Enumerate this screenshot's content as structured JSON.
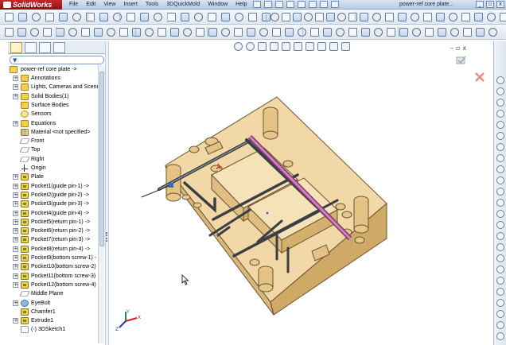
{
  "app": {
    "brand": "SolidWorks",
    "document_title": "power-ref core plate...",
    "menus": [
      "File",
      "Edit",
      "View",
      "Insert",
      "Tools",
      "3DQuickMold",
      "Window",
      "Help"
    ]
  },
  "window_controls": [
    "_",
    "▫",
    "x"
  ],
  "viewport_controls": [
    "–",
    "▫",
    "x"
  ],
  "feature_tree": {
    "root": "power-ref core plate ->",
    "items": [
      {
        "label": "Annotations",
        "icon": "folder-a",
        "expand": "+"
      },
      {
        "label": "Lights, Cameras and Scene",
        "icon": "folder",
        "expand": "+"
      },
      {
        "label": "Solid Bodies(1)",
        "icon": "folder",
        "expand": "+"
      },
      {
        "label": "Surface Bodies",
        "icon": "folder",
        "expand": ""
      },
      {
        "label": "Sensors",
        "icon": "sensor",
        "expand": ""
      },
      {
        "label": "Equations",
        "icon": "folder",
        "expand": "+"
      },
      {
        "label": "Material <not specified>",
        "icon": "mat",
        "expand": ""
      },
      {
        "label": "Front",
        "icon": "plane",
        "expand": ""
      },
      {
        "label": "Top",
        "icon": "plane",
        "expand": ""
      },
      {
        "label": "Right",
        "icon": "plane",
        "expand": ""
      },
      {
        "label": "Origin",
        "icon": "origin",
        "expand": ""
      },
      {
        "label": "Plate",
        "icon": "feat",
        "expand": "+"
      },
      {
        "label": "Pocket1(guide pin-1) ->",
        "icon": "feat",
        "expand": "+"
      },
      {
        "label": "Pocket2(guide pin-2) ->",
        "icon": "feat",
        "expand": "+"
      },
      {
        "label": "Pocket3(guide pin-3) ->",
        "icon": "feat",
        "expand": "+"
      },
      {
        "label": "Pocket4(guide pin-4) ->",
        "icon": "feat",
        "expand": "+"
      },
      {
        "label": "Pocket5(return pin-1) ->",
        "icon": "feat",
        "expand": "+"
      },
      {
        "label": "Pocket6(return pin-2) ->",
        "icon": "feat",
        "expand": "+"
      },
      {
        "label": "Pocket7(return pin-3) ->",
        "icon": "feat",
        "expand": "+"
      },
      {
        "label": "Pocket8(return pin-4) ->",
        "icon": "feat",
        "expand": "+"
      },
      {
        "label": "Pocket9(bottom screw-1) -",
        "icon": "feat",
        "expand": "+"
      },
      {
        "label": "Pocket10(bottom screw-2)",
        "icon": "feat",
        "expand": "+"
      },
      {
        "label": "Pocket11(bottom screw-3)",
        "icon": "feat",
        "expand": "+"
      },
      {
        "label": "Pocket12(bottom screw-4)",
        "icon": "feat",
        "expand": "+"
      },
      {
        "label": "Middle Plane",
        "icon": "plane",
        "expand": ""
      },
      {
        "label": "EyeBolt",
        "icon": "eye",
        "expand": "+"
      },
      {
        "label": "Chamfer1",
        "icon": "feat",
        "expand": ""
      },
      {
        "label": "Extrude1",
        "icon": "feat",
        "expand": "+"
      },
      {
        "label": "(-) 3DSketch1",
        "icon": "sketch",
        "expand": ""
      }
    ]
  },
  "triad": {
    "x_label": "X",
    "y_label": "Y",
    "z_label": "Z"
  },
  "colors": {
    "plate": "#e9c98b",
    "rail": "#c66fb1",
    "accent": "#c8262b",
    "tree_selection": "#fff4c9"
  }
}
